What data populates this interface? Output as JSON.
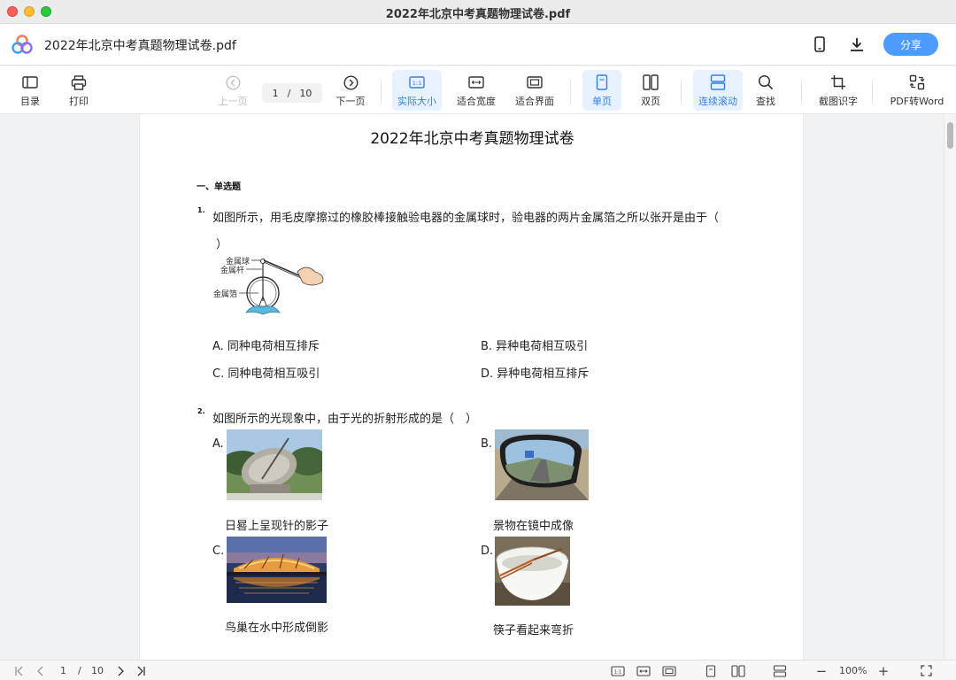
{
  "window": {
    "title": "2022年北京中考真题物理试卷.pdf"
  },
  "header": {
    "doc_title": "2022年北京中考真题物理试卷.pdf",
    "share_label": "分享"
  },
  "toolbar": {
    "toc": "目录",
    "print": "打印",
    "prev_page": "上一页",
    "current_page": "1",
    "page_sep": "/",
    "total_pages": "10",
    "next_page": "下一页",
    "actual_size": "实际大小",
    "fit_width": "适合宽度",
    "fit_screen": "适合界面",
    "single_page": "单页",
    "double_page": "双页",
    "continuous": "连续滚动",
    "find": "查找",
    "ocr": "截图识字",
    "to_word": "PDF转Word"
  },
  "document": {
    "title": "2022年北京中考真题物理试卷",
    "section": "一、单选题",
    "q1": {
      "num": "1.",
      "text_line1": "如图所示，用毛皮摩擦过的橡胶棒接触验电器的金属球时，验电器的两片金属箔之所以张开是由于（",
      "text_line2": "）",
      "figure_labels": {
        "ball": "金属球",
        "rod": "金属杆",
        "foil": "金属箔"
      },
      "options": {
        "A": "A. 同种电荷相互排斥",
        "B": "B. 异种电荷相互吸引",
        "C": "C. 同种电荷相互吸引",
        "D": "D. 异种电荷相互排斥"
      }
    },
    "q2": {
      "num": "2.",
      "text": "如图所示的光现象中，由于光的折射形成的是（　）",
      "options": {
        "A": {
          "letter": "A.",
          "caption": "日晷上呈现针的影子"
        },
        "B": {
          "letter": "B.",
          "caption": "景物在镜中成像"
        },
        "C": {
          "letter": "C.",
          "caption": "鸟巢在水中形成倒影"
        },
        "D": {
          "letter": "D.",
          "caption": "筷子看起来弯折"
        }
      }
    }
  },
  "statusbar": {
    "current_page": "1",
    "sep": "/",
    "total_pages": "10",
    "zoom": "100%",
    "minus": "−",
    "plus": "+"
  },
  "colors": {
    "accent": "#4c9bff",
    "active_bg": "#e8f1ff",
    "active_text": "#2f80ed"
  }
}
